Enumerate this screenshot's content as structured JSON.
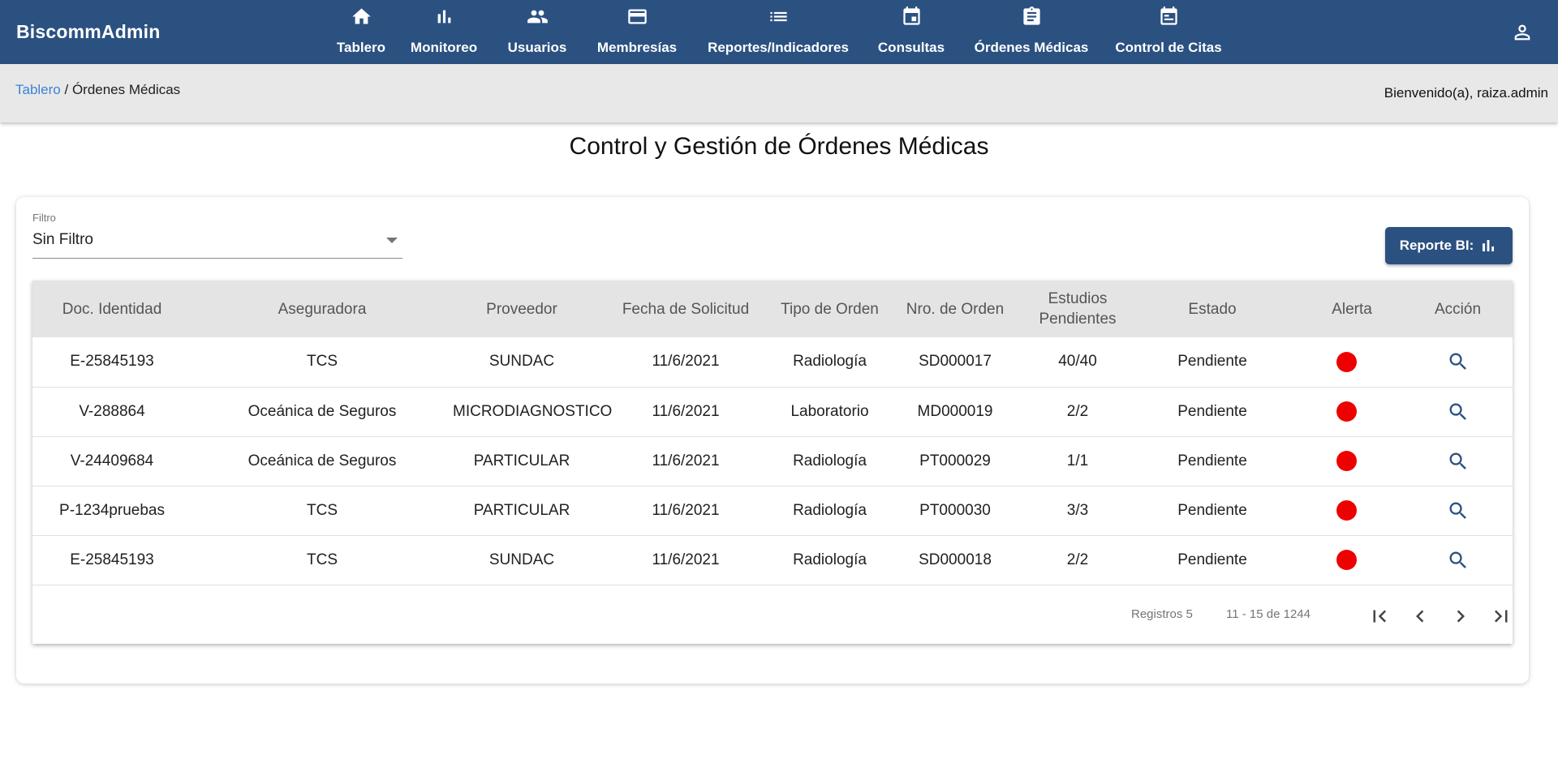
{
  "app": {
    "title": "BiscommAdmin"
  },
  "nav": [
    {
      "label": "Tablero",
      "icon": "home-icon"
    },
    {
      "label": "Monitoreo",
      "icon": "bar-chart-icon"
    },
    {
      "label": "Usuarios",
      "icon": "people-icon"
    },
    {
      "label": "Membresías",
      "icon": "credit-card-icon"
    },
    {
      "label": "Reportes/Indicadores",
      "icon": "list-icon"
    },
    {
      "label": "Consultas",
      "icon": "calendar-icon"
    },
    {
      "label": "Órdenes Médicas",
      "icon": "clipboard-icon"
    },
    {
      "label": "Control de Citas",
      "icon": "calendar-icon"
    }
  ],
  "user_icon": "person-icon",
  "breadcrumb": {
    "home": "Tablero",
    "separator": " / ",
    "current": "Órdenes Médicas"
  },
  "welcome": "Bienvenido(a), raiza.admin",
  "page_title": "Control y Gestión de Órdenes Médicas",
  "filter": {
    "label": "Filtro",
    "value": "Sin Filtro"
  },
  "bi_button": {
    "label": "Reporte BI:",
    "icon": "bar-chart-icon"
  },
  "table": {
    "headers": [
      "Doc. Identidad",
      "Aseguradora",
      "Proveedor",
      "Fecha de Solicitud",
      "Tipo de Orden",
      "Nro. de Orden",
      "Estudios Pendientes",
      "Estado",
      "Alerta",
      "Acción"
    ],
    "rows": [
      {
        "doc": "E-25845193",
        "aseguradora": "TCS",
        "proveedor": "SUNDAC",
        "fecha": "11/6/2021",
        "tipo": "Radiología",
        "nro": "SD000017",
        "estudios": "40/40",
        "estado": "Pendiente"
      },
      {
        "doc": "V-288864",
        "aseguradora": "Oceánica de Seguros",
        "proveedor": "MICRODIAGNOSTICO",
        "fecha": "11/6/2021",
        "tipo": "Laboratorio",
        "nro": "MD000019",
        "estudios": "2/2",
        "estado": "Pendiente"
      },
      {
        "doc": "V-24409684",
        "aseguradora": "Oceánica de Seguros",
        "proveedor": "PARTICULAR",
        "fecha": "11/6/2021",
        "tipo": "Radiología",
        "nro": "PT000029",
        "estudios": "1/1",
        "estado": "Pendiente"
      },
      {
        "doc": "P-1234pruebas",
        "aseguradora": "TCS",
        "proveedor": "PARTICULAR",
        "fecha": "11/6/2021",
        "tipo": "Radiología",
        "nro": "PT000030",
        "estudios": "3/3",
        "estado": "Pendiente"
      },
      {
        "doc": "E-25845193",
        "aseguradora": "TCS",
        "proveedor": "SUNDAC",
        "fecha": "11/6/2021",
        "tipo": "Radiología",
        "nro": "SD000018",
        "estudios": "2/2",
        "estado": "Pendiente"
      }
    ],
    "alert_color": "#ee0000",
    "action_icon": "search-icon"
  },
  "pagination": {
    "page_size": "Registros 5",
    "range": "11 - 15 de 1244",
    "buttons": [
      "first-page-icon",
      "previous-page-icon",
      "next-page-icon",
      "last-page-icon"
    ]
  },
  "colors": {
    "primary": "#2b5181",
    "link": "#3b82d6",
    "header_bg": "#e4e4e4",
    "crumb_bg": "#e8e8e8"
  }
}
